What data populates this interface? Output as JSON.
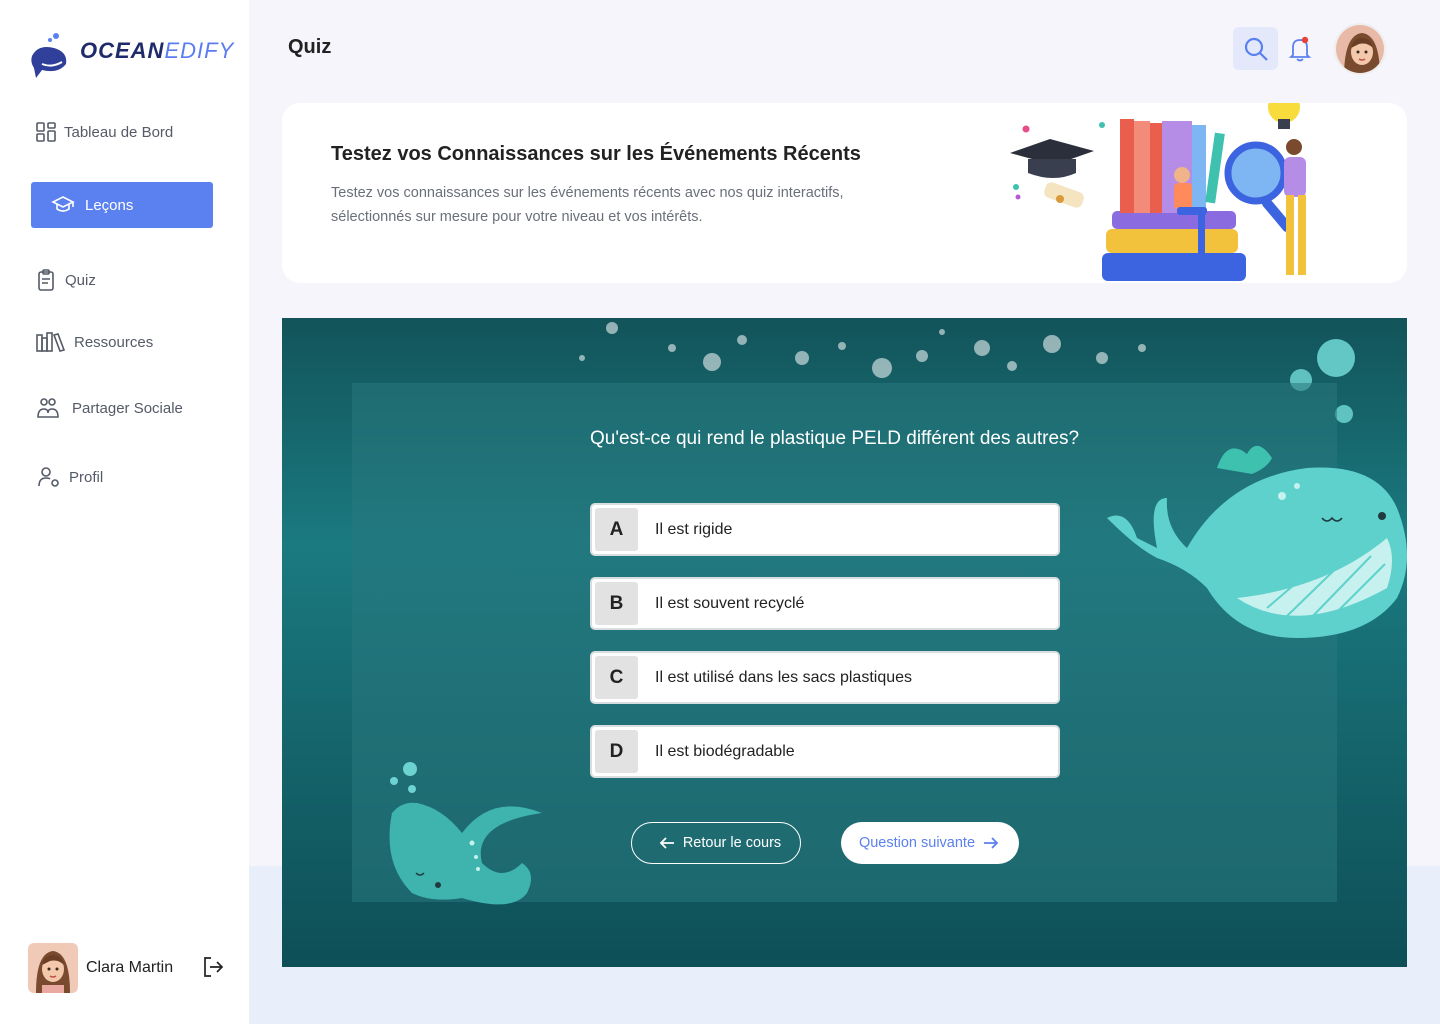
{
  "brand": {
    "name_part1": "OCEAN",
    "name_part2": "EDIFY"
  },
  "sidebar": {
    "items": [
      {
        "label": "Tableau de Bord",
        "icon": "dashboard-icon"
      },
      {
        "label": "Leçons",
        "icon": "graduation-cap-icon",
        "active": true
      },
      {
        "label": "Quiz",
        "icon": "clipboard-icon"
      },
      {
        "label": "Ressources",
        "icon": "library-icon"
      },
      {
        "label": "Partager Sociale",
        "icon": "users-icon"
      },
      {
        "label": "Profil",
        "icon": "user-settings-icon"
      }
    ],
    "user": {
      "name": "Clara Martin"
    }
  },
  "header": {
    "title": "Quiz"
  },
  "banner": {
    "title": "Testez vos Connaissances sur les Événements Récents",
    "description": "Testez vos connaissances sur les événements récents avec nos quiz interactifs, sélectionnés sur mesure pour votre niveau et vos intérêts."
  },
  "quiz": {
    "question": "Qu'est-ce qui rend le plastique PELD différent des autres?",
    "options": [
      {
        "letter": "A",
        "text": "Il est rigide"
      },
      {
        "letter": "B",
        "text": "Il est souvent recyclé"
      },
      {
        "letter": "C",
        "text": "Il est utilisé dans les sacs plastiques"
      },
      {
        "letter": "D",
        "text": "Il est biodégradable"
      }
    ],
    "back_label": "Retour le cours",
    "next_label": "Question suivante"
  },
  "colors": {
    "accent": "#5b80ef",
    "ocean": "#16686f",
    "notification": "#e8413b"
  }
}
